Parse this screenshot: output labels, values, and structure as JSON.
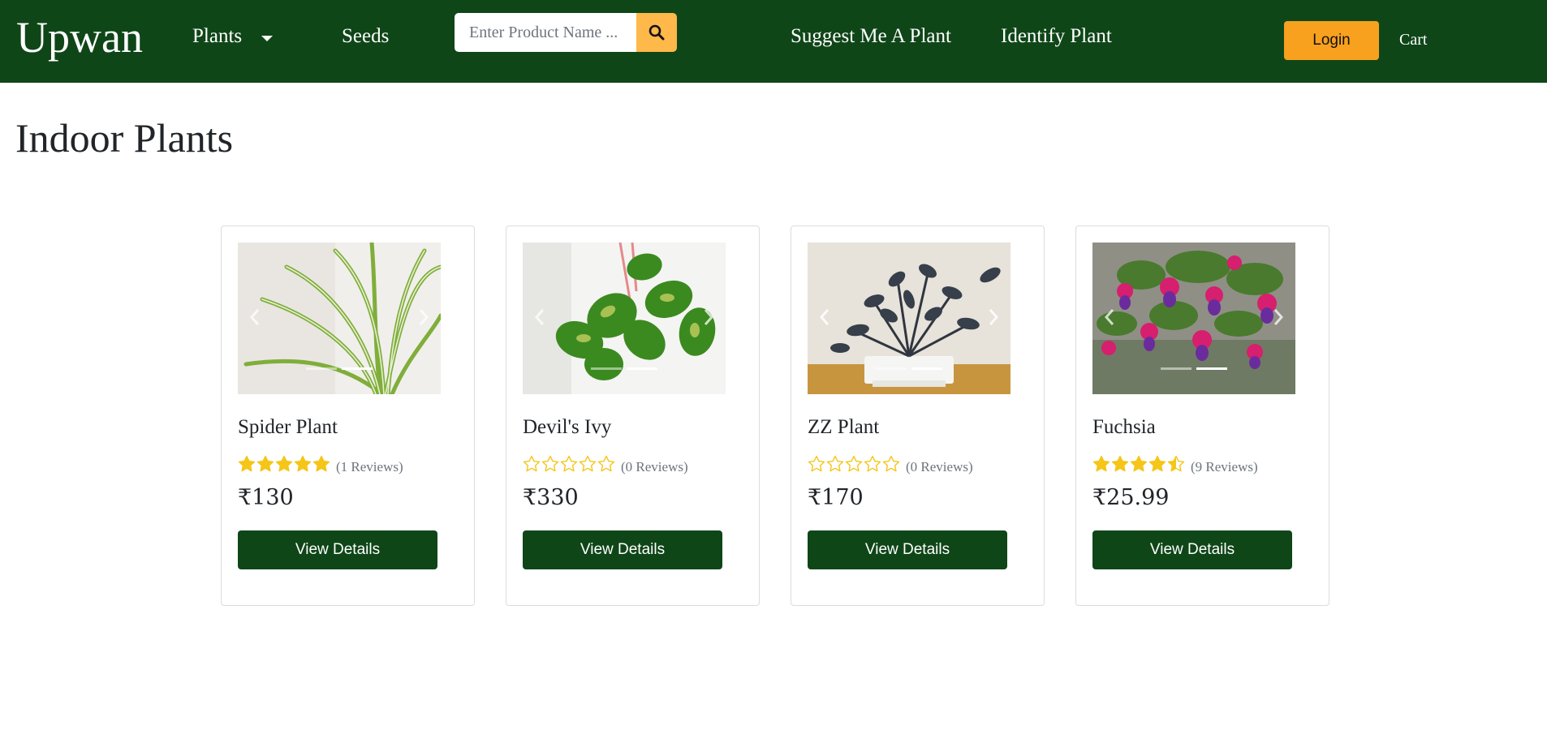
{
  "brand": "Upwan",
  "nav": {
    "plants": "Plants",
    "seeds": "Seeds",
    "suggest": "Suggest Me A Plant",
    "identify": "Identify Plant",
    "login": "Login",
    "cart": "Cart"
  },
  "search": {
    "placeholder": "Enter Product Name ..."
  },
  "page_title": "Indoor Plants",
  "colors": {
    "navbar": "#0f4618",
    "accent": "#f8a11e",
    "search_button": "#ffb84a",
    "star": "#f5c518",
    "button": "#0f4618"
  },
  "products": [
    {
      "name": "Spider Plant",
      "rating": 5,
      "reviews": "(1 Reviews)",
      "price": "₹130",
      "button": "View Details",
      "active_slide": 2,
      "slides": 2
    },
    {
      "name": "Devil's Ivy",
      "rating": 0,
      "reviews": "(0 Reviews)",
      "price": "₹330",
      "button": "View Details",
      "active_slide": 2,
      "slides": 2
    },
    {
      "name": "ZZ Plant",
      "rating": 0,
      "reviews": "(0 Reviews)",
      "price": "₹170",
      "button": "View Details",
      "active_slide": 2,
      "slides": 2
    },
    {
      "name": "Fuchsia",
      "rating": 4.5,
      "reviews": "(9 Reviews)",
      "price": "₹25.99",
      "button": "View Details",
      "active_slide": 2,
      "slides": 2
    }
  ]
}
